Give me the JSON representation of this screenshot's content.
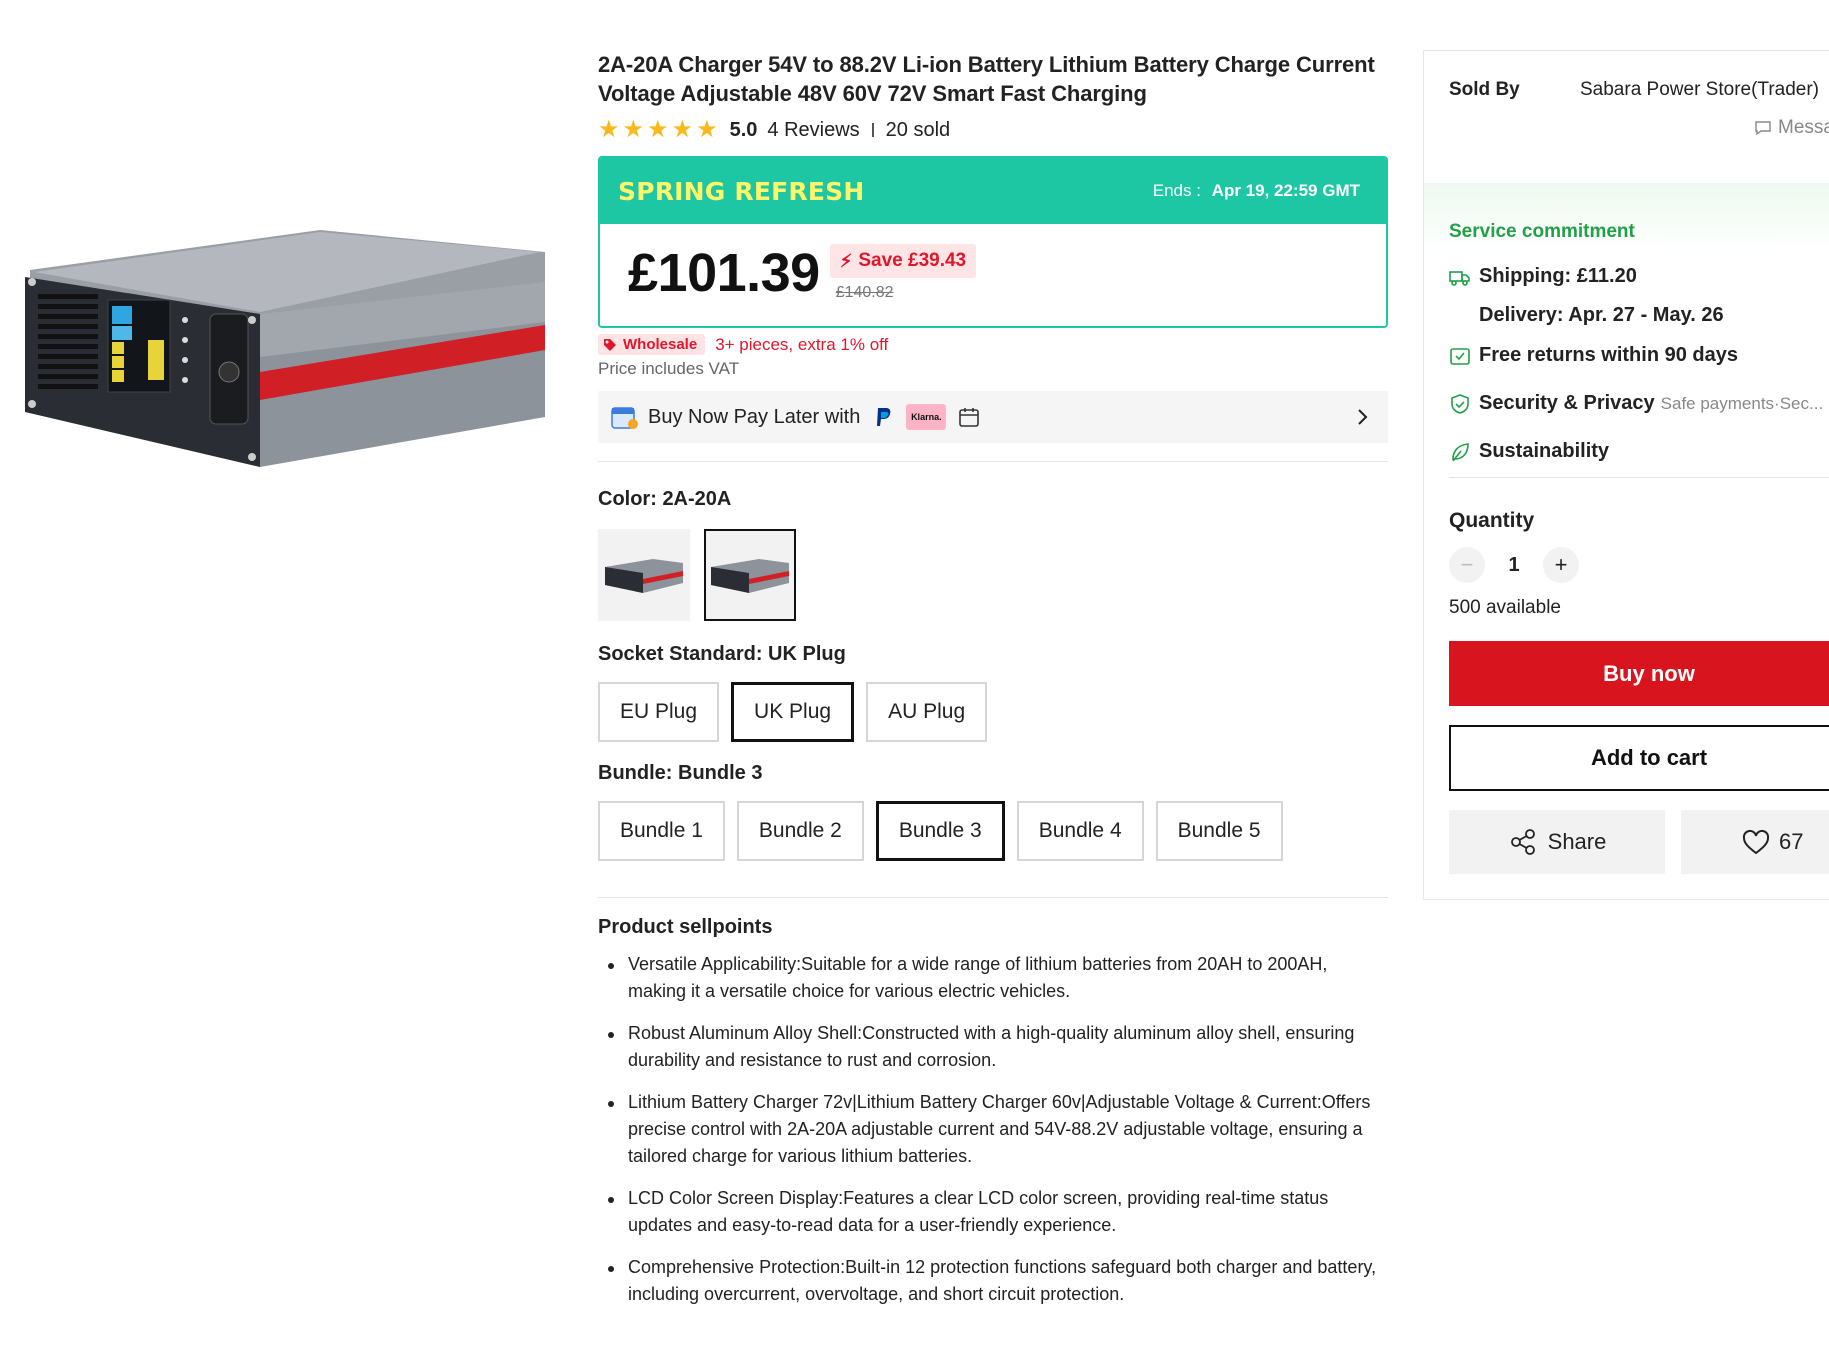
{
  "product": {
    "title": "2A-20A Charger 54V to 88.2V Li-ion Battery Lithium Battery Charge Current Voltage Adjustable 48V 60V 72V Smart Fast Charging",
    "rating": "5.0",
    "stars": 5,
    "reviews": "4 Reviews",
    "sold": "20 sold"
  },
  "promo": {
    "name": "SPRING REFRESH",
    "ends_label": "Ends :",
    "ends_value": "Apr 19, 22:59 GMT",
    "price": "£101.39",
    "save": "Save £39.43",
    "old_price": "£140.82"
  },
  "wholesale": {
    "tag": "Wholesale",
    "note": "3+ pieces, extra 1% off"
  },
  "vat": "Price includes VAT",
  "paylater": {
    "label": "Buy Now Pay Later with",
    "klarna": "Klarna."
  },
  "options": {
    "color": {
      "label": "Color: ",
      "value": "2A-20A",
      "selected_index": 1,
      "swatches": [
        "swatch-1",
        "swatch-2"
      ]
    },
    "socket": {
      "label": "Socket Standard: ",
      "value": "UK Plug",
      "choices": [
        "EU Plug",
        "UK Plug",
        "AU Plug"
      ],
      "selected_index": 1
    },
    "bundle": {
      "label": "Bundle: ",
      "value": "Bundle 3",
      "choices": [
        "Bundle 1",
        "Bundle 2",
        "Bundle 3",
        "Bundle 4",
        "Bundle 5"
      ],
      "selected_index": 2
    }
  },
  "sellpoints": {
    "title": "Product sellpoints",
    "items": [
      "Versatile Applicability:Suitable for a wide range of lithium batteries from 20AH to 200AH, making it a versatile choice for various electric vehicles.",
      "Robust Aluminum Alloy Shell:Constructed with a high-quality aluminum alloy shell, ensuring durability and resistance to rust and corrosion.",
      "Lithium Battery Charger 72v|Lithium Battery Charger 60v|Adjustable Voltage & Current:Offers precise control with 2A-20A adjustable current and 54V-88.2V adjustable voltage, ensuring a tailored charge for various lithium batteries.",
      "LCD Color Screen Display:Features a clear LCD color screen, providing real-time status updates and easy-to-read data for a user-friendly experience.",
      "Comprehensive Protection:Built-in 12 protection functions safeguard both charger and battery, including overcurrent, overvoltage, and short circuit protection."
    ]
  },
  "side": {
    "sold_by_label": "Sold By",
    "seller": "Sabara Power Store(Trader)",
    "message": "Message",
    "service_title": "Service commitment",
    "shipping_label": "Shipping:",
    "shipping_value": "£11.20",
    "delivery": "Delivery: Apr. 27 - May. 26",
    "returns": "Free returns within 90 days",
    "security": "Security & Privacy",
    "security_sub": "Safe payments·Sec...",
    "sustainability": "Sustainability",
    "quantity_label": "Quantity",
    "quantity_value": "1",
    "available": "500 available",
    "buy_now": "Buy now",
    "add_to_cart": "Add to cart",
    "share": "Share",
    "wishlist_count": "67"
  },
  "colors": {
    "accent_green": "#1ec7a3",
    "promo_text": "#fff56a",
    "sale_red": "#e0162b",
    "buy_red": "#d8141f",
    "service_green": "#21a048",
    "star": "#fbb81c"
  }
}
